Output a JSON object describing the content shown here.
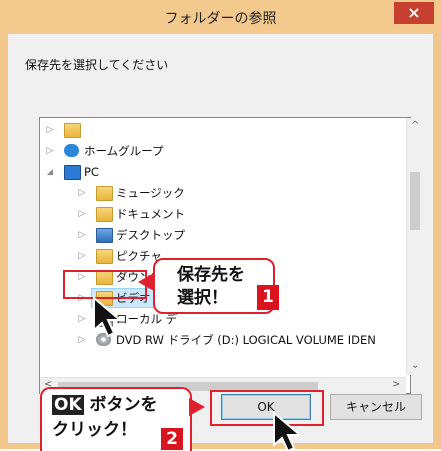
{
  "window": {
    "title": "フォルダーの参照",
    "close_glyph": "×"
  },
  "instruction": "保存先を選択してください",
  "tree": {
    "items": [
      {
        "label": "",
        "level": 0,
        "expander": "▷"
      },
      {
        "label": "ホームグループ",
        "level": 0,
        "expander": "▷"
      },
      {
        "label": "PC",
        "level": 0,
        "expander": "◢"
      },
      {
        "label": "ミュージック",
        "level": 1,
        "expander": "▷"
      },
      {
        "label": "ドキュメント",
        "level": 1,
        "expander": "▷"
      },
      {
        "label": "デスクトップ",
        "level": 1,
        "expander": "▷"
      },
      {
        "label": "ピクチャ",
        "level": 1,
        "expander": "▷"
      },
      {
        "label": "ダウンロード",
        "level": 1,
        "expander": "▷"
      },
      {
        "label": "ビデオ",
        "level": 1,
        "expander": "▷",
        "selected": true
      },
      {
        "label": "ローカル デ",
        "level": 1,
        "expander": "▷"
      },
      {
        "label": "DVD RW ドライブ (D:) LOGICAL VOLUME IDEN",
        "level": 1,
        "expander": "▷"
      }
    ]
  },
  "scroll": {
    "up": "^",
    "down": "⌄",
    "left": "<",
    "right": ">"
  },
  "buttons": {
    "ok": "OK",
    "cancel": "キャンセル"
  },
  "callouts": {
    "select": {
      "line1": "保存先を",
      "line2": "選択！",
      "number": "1"
    },
    "click": {
      "line1_prefix": "OK",
      "line1_suffix": " ボタンを",
      "line2": "クリック！",
      "number": "2"
    }
  },
  "colors": {
    "accent_red": "#d9141f",
    "title_bg": "#f3c98e",
    "selection": "#cce8ff"
  }
}
